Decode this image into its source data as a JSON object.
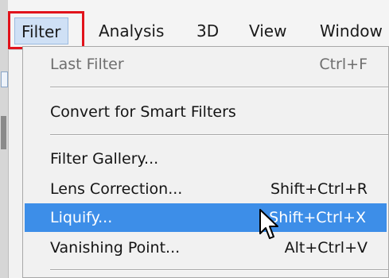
{
  "menubar": {
    "items": [
      {
        "label": "Filter",
        "active": true
      },
      {
        "label": "Analysis"
      },
      {
        "label": "3D"
      },
      {
        "label": "View"
      },
      {
        "label": "Window"
      }
    ]
  },
  "dropdown": {
    "last_filter": {
      "label": "Last Filter",
      "shortcut": "Ctrl+F",
      "enabled": false
    },
    "convert_smart": {
      "label": "Convert for Smart Filters"
    },
    "filter_gallery": {
      "label": "Filter Gallery..."
    },
    "lens_correction": {
      "label": "Lens Correction...",
      "shortcut": "Shift+Ctrl+R"
    },
    "liquify": {
      "label": "Liquify...",
      "shortcut": "Shift+Ctrl+X",
      "selected": true
    },
    "vanishing_point": {
      "label": "Vanishing Point...",
      "shortcut": "Alt+Ctrl+V"
    }
  },
  "colors": {
    "highlight_box": "#e1131c",
    "selected_row": "#3d8ee8"
  },
  "icons": {
    "cursor": "mouse-pointer-icon"
  }
}
